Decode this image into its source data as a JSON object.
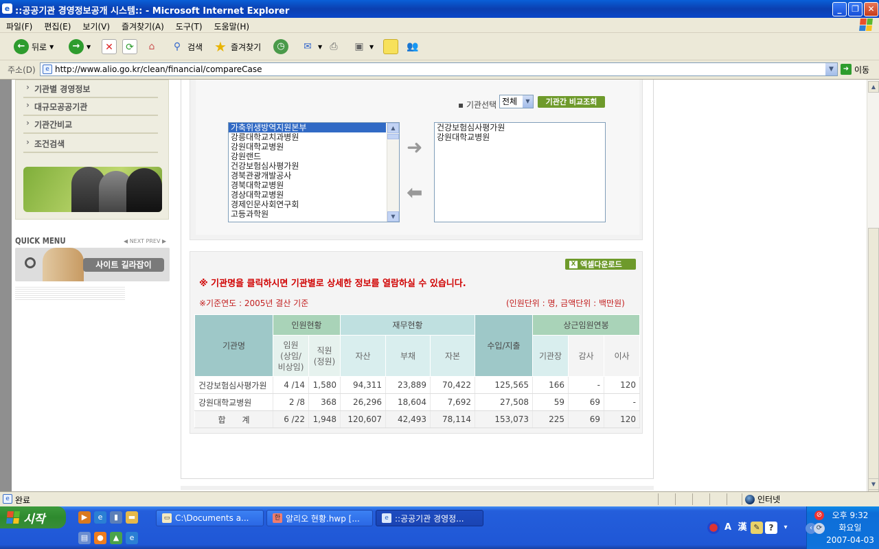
{
  "window": {
    "title": "::공공기관 경영정보공개 시스템:: - Microsoft Internet Explorer",
    "icon": "ie-icon"
  },
  "menu": [
    "파일(F)",
    "편집(E)",
    "보기(V)",
    "즐겨찾기(A)",
    "도구(T)",
    "도움말(H)"
  ],
  "toolbar": {
    "back": "뒤로",
    "search": "검색",
    "favorites": "즐겨찾기"
  },
  "address": {
    "label": "주소(D)",
    "url": "http://www.alio.go.kr/clean/financial/compareCase",
    "go": "이동"
  },
  "sidebar": {
    "items": [
      "기관별 경영정보",
      "대규모공공기관",
      "기관간비교",
      "조건검색"
    ],
    "quick_menu": "QUICK MENU",
    "next_prev": "◀ NEXT  PREV ▶",
    "guide_button": "사이트 길라잡이"
  },
  "selector": {
    "org_label": "▪ 기관선택",
    "org_value": "전체",
    "compare_button": "기관간 비교조회",
    "left_list": [
      "가축위생방역지원본부",
      "강릉대학교치과병원",
      "강원대학교병원",
      "강원랜드",
      "건강보험심사평가원",
      "경북관광개발공사",
      "경북대학교병원",
      "경상대학교병원",
      "경제인문사회연구회",
      "고등과학원"
    ],
    "left_selected_index": 0,
    "right_list": [
      "건강보험심사평가원",
      "강원대학교병원"
    ],
    "move_right_arrow": "➜",
    "move_left_arrow": "⬅"
  },
  "result": {
    "excel_button": "엑셀다운로드",
    "notice": "※ 기관명을 클릭하시면 기관별로 상세한 정보를 열람하실 수 있습니다.",
    "basis": "※기준연도 : 2005년 결산 기준",
    "unit": "(인원단위 : 명, 금액단위 : 백만원)",
    "headers": {
      "org": "기관명",
      "staff": "인원현황",
      "finance": "재무현황",
      "income": "수입/지출",
      "exec": "상근임원연봉",
      "exec_officer": "임원\n(상임/\n비상임)",
      "employee": "직원\n(정원)",
      "asset": "자산",
      "debt": "부채",
      "capital": "자본",
      "head": "기관장",
      "auditor": "감사",
      "director": "이사"
    },
    "rows": [
      [
        "건강보험심사평가원",
        "4 /14",
        "1,580",
        "94,311",
        "23,889",
        "70,422",
        "125,565",
        "166",
        "-",
        "120"
      ],
      [
        "강원대학교병원",
        "2 /8",
        "368",
        "26,296",
        "18,604",
        "7,692",
        "27,508",
        "59",
        "69",
        "-"
      ],
      [
        "합　　계",
        "6 /22",
        "1,948",
        "120,607",
        "42,493",
        "78,114",
        "153,073",
        "225",
        "69",
        "120"
      ]
    ]
  },
  "status": {
    "text": "완료",
    "zone": "인터넷"
  },
  "taskbar": {
    "start": "시작",
    "tasks": [
      "C:\\Documents a...",
      "알리오 현황.hwp [...",
      "::공공기관 경영정..."
    ],
    "active_task_index": 2,
    "ime": [
      "A",
      "漢"
    ],
    "clock_time": "오후 9:32",
    "clock_day": "화요일",
    "clock_date": "2007-04-03"
  }
}
